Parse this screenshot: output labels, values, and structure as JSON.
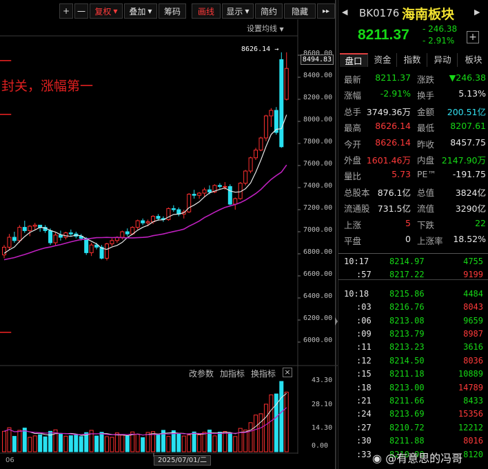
{
  "toolbar": {
    "plus": "+",
    "minus": "一",
    "fuquan": "复权",
    "diejia": "叠加",
    "chouma": "筹码",
    "huaxian": "画线",
    "xianshi": "显示",
    "jianyue": "简约",
    "yincang": "隐藏",
    "more": "▸▸"
  },
  "chart_settings": "设置均线",
  "annotations": {
    "line1": "一",
    "line2": "封关，涨幅第一",
    "line3": "一",
    "line4": "一"
  },
  "price_axis_labels": [
    "8600.00",
    "8400.00",
    "8200.00",
    "8000.00",
    "7800.00",
    "7600.00",
    "7400.00",
    "7200.00",
    "7000.00",
    "6800.00",
    "6600.00",
    "6400.00",
    "6200.00",
    "6000.00"
  ],
  "current_price_tag": "8494.83",
  "high_marker": "8626.14",
  "volume_panel": {
    "buttons": [
      "改参数",
      "加指标",
      "换指标"
    ],
    "close_icon": "×",
    "axis": [
      "43.30",
      "28.10",
      "14.30",
      "0.00"
    ]
  },
  "date_axis": {
    "left": "06",
    "center": "2025/07/01/二"
  },
  "chart_data": {
    "type": "candlestick",
    "yaxis_range": [
      6000,
      8700
    ],
    "ohlc": [
      [
        6790,
        6880,
        6760,
        6860
      ],
      [
        6860,
        6980,
        6840,
        6950
      ],
      [
        6950,
        7000,
        6900,
        6920
      ],
      [
        6920,
        7060,
        6900,
        7040
      ],
      [
        7040,
        7100,
        6990,
        7010
      ],
      [
        7010,
        7060,
        6960,
        7050
      ],
      [
        7050,
        7080,
        7020,
        7060
      ],
      [
        7060,
        7050,
        7000,
        7040
      ],
      [
        7040,
        7060,
        6990,
        7010
      ],
      [
        7010,
        7030,
        6880,
        6900
      ],
      [
        6900,
        6990,
        6880,
        6970
      ],
      [
        6970,
        7010,
        6920,
        6950
      ],
      [
        6950,
        7000,
        6930,
        6990
      ],
      [
        6990,
        7020,
        6960,
        6980
      ],
      [
        6980,
        7000,
        6940,
        6960
      ],
      [
        6960,
        6980,
        6920,
        6940
      ],
      [
        6940,
        6950,
        6790,
        6810
      ],
      [
        6810,
        6900,
        6780,
        6880
      ],
      [
        6880,
        6900,
        6840,
        6860
      ],
      [
        6860,
        6880,
        6750,
        6760
      ],
      [
        6760,
        6900,
        6740,
        6890
      ],
      [
        6890,
        6940,
        6870,
        6920
      ],
      [
        6920,
        6960,
        6900,
        6950
      ],
      [
        6950,
        7010,
        6930,
        7000
      ],
      [
        7000,
        7030,
        6960,
        6980
      ],
      [
        6980,
        7050,
        6970,
        7040
      ],
      [
        7040,
        7110,
        7020,
        7100
      ],
      [
        7100,
        7120,
        7060,
        7080
      ],
      [
        7080,
        7110,
        7050,
        7090
      ],
      [
        7090,
        7150,
        7070,
        7140
      ],
      [
        7140,
        7160,
        7100,
        7120
      ],
      [
        7120,
        7140,
        7090,
        7110
      ],
      [
        7110,
        7220,
        7100,
        7210
      ],
      [
        7210,
        7240,
        7180,
        7200
      ],
      [
        7200,
        7220,
        7140,
        7160
      ],
      [
        7160,
        7200,
        7120,
        7180
      ],
      [
        7180,
        7350,
        7170,
        7340
      ],
      [
        7340,
        7380,
        7300,
        7330
      ],
      [
        7330,
        7360,
        7300,
        7350
      ],
      [
        7350,
        7400,
        7320,
        7380
      ],
      [
        7380,
        7420,
        7340,
        7360
      ],
      [
        7360,
        7430,
        7350,
        7420
      ],
      [
        7420,
        7440,
        7390,
        7410
      ],
      [
        7410,
        7450,
        7380,
        7410
      ],
      [
        7410,
        7430,
        7240,
        7250
      ],
      [
        7250,
        7310,
        7200,
        7300
      ],
      [
        7300,
        7450,
        7290,
        7440
      ],
      [
        7440,
        7560,
        7420,
        7550
      ],
      [
        7550,
        7680,
        7530,
        7670
      ],
      [
        7670,
        7760,
        7650,
        7740
      ],
      [
        7740,
        7860,
        7730,
        7850
      ],
      [
        7850,
        8060,
        7820,
        8050
      ],
      [
        8050,
        8120,
        7950,
        8100
      ],
      [
        8100,
        8130,
        7880,
        7900
      ],
      [
        8560,
        8626,
        7760,
        7770
      ],
      [
        8200,
        8626,
        8190,
        8480
      ]
    ],
    "ma_short_start": 6790,
    "ma_long_start": 6740,
    "volume": [
      12.6,
      14.8,
      9.5,
      13.2,
      14.6,
      8.9,
      9.8,
      10.5,
      9.2,
      12.6,
      13.5,
      10.8,
      9.6,
      9.9,
      10.8,
      9.4,
      11.8,
      13.2,
      9.7,
      12.0,
      9.3,
      8.9,
      11.6,
      10.2,
      9.6,
      12.2,
      10.9,
      8.7,
      11.9,
      12.4,
      10.7,
      13.2,
      9.5,
      13.0,
      11.0,
      9.7,
      10.3,
      12.2,
      10.4,
      12.0,
      13.4,
      9.8,
      12.1,
      12.5,
      11.6,
      9.4,
      14.4,
      13.4,
      17.9,
      22.6,
      23.4,
      29.3,
      35.0,
      35.6,
      43.3,
      36.7
    ]
  },
  "stock": {
    "code": "BK0176",
    "name": "海南板块",
    "price": "8211.37",
    "change": "- 246.38",
    "change_pct": "- 2.91%",
    "add_icon": "+"
  },
  "tabs": [
    "盘口",
    "资金",
    "指数",
    "异动",
    "板块"
  ],
  "stats": [
    {
      "l1": "最新",
      "v1": "8211.37",
      "c1": "green",
      "l2": "涨跌",
      "v2": "▼246.38",
      "c2": "green"
    },
    {
      "l1": "涨幅",
      "v1": "-2.91%",
      "c1": "green",
      "l2": "换手",
      "v2": "5.13%",
      "c2": "white"
    },
    {
      "l1": "总手",
      "v1": "3749.36万",
      "c1": "white",
      "l2": "金额",
      "v2": "200.51亿",
      "c2": "cyan"
    },
    {
      "l1": "最高",
      "v1": "8626.14",
      "c1": "red",
      "l2": "最低",
      "v2": "8207.61",
      "c2": "green"
    },
    {
      "l1": "今开",
      "v1": "8626.14",
      "c1": "red",
      "l2": "昨收",
      "v2": "8457.75",
      "c2": "white"
    },
    {
      "l1": "外盘",
      "v1": "1601.46万",
      "c1": "red",
      "l2": "内盘",
      "v2": "2147.90万",
      "c2": "green"
    },
    {
      "l1": "量比",
      "v1": "5.73",
      "c1": "red",
      "l2": "PE™",
      "v2": "-191.75",
      "c2": "white"
    },
    {
      "l1": "总股本",
      "v1": "876.1亿",
      "c1": "white",
      "l2": "总值",
      "v2": "3824亿",
      "c2": "white"
    },
    {
      "l1": "流通股",
      "v1": "731.5亿",
      "c1": "white",
      "l2": "流值",
      "v2": "3290亿",
      "c2": "white"
    },
    {
      "l1": "上涨",
      "v1": "5",
      "c1": "red",
      "l2": "下跌",
      "v2": "22",
      "c2": "green"
    },
    {
      "l1": "平盘",
      "v1": "0",
      "c1": "white",
      "l2": "上涨率",
      "v2": "18.52%",
      "c2": "white"
    }
  ],
  "ticks": [
    {
      "t": "10:17",
      "p": "8214.97",
      "v": "4755",
      "vc": "green"
    },
    {
      "t": ":57",
      "p": "8217.22",
      "v": "9199",
      "vc": "red"
    },
    {
      "t": "10:18",
      "p": "8215.86",
      "v": "4484",
      "vc": "green"
    },
    {
      "t": ":03",
      "p": "8216.76",
      "v": "8043",
      "vc": "red"
    },
    {
      "t": ":06",
      "p": "8213.08",
      "v": "9659",
      "vc": "green"
    },
    {
      "t": ":09",
      "p": "8213.79",
      "v": "8987",
      "vc": "red"
    },
    {
      "t": ":11",
      "p": "8213.23",
      "v": "3616",
      "vc": "green"
    },
    {
      "t": ":12",
      "p": "8214.50",
      "v": "8036",
      "vc": "red"
    },
    {
      "t": ":15",
      "p": "8211.18",
      "v": "10889",
      "vc": "green"
    },
    {
      "t": ":18",
      "p": "8213.00",
      "v": "14789",
      "vc": "red"
    },
    {
      "t": ":21",
      "p": "8211.66",
      "v": "8433",
      "vc": "green"
    },
    {
      "t": ":24",
      "p": "8213.69",
      "v": "15356",
      "vc": "red"
    },
    {
      "t": ":27",
      "p": "8210.72",
      "v": "12212",
      "vc": "green"
    },
    {
      "t": ":30",
      "p": "8211.88",
      "v": "8016",
      "vc": "red"
    },
    {
      "t": ":33",
      "p": "8210.90",
      "v": "8120",
      "vc": "green"
    }
  ],
  "watermark": "@有意思的冯哥"
}
